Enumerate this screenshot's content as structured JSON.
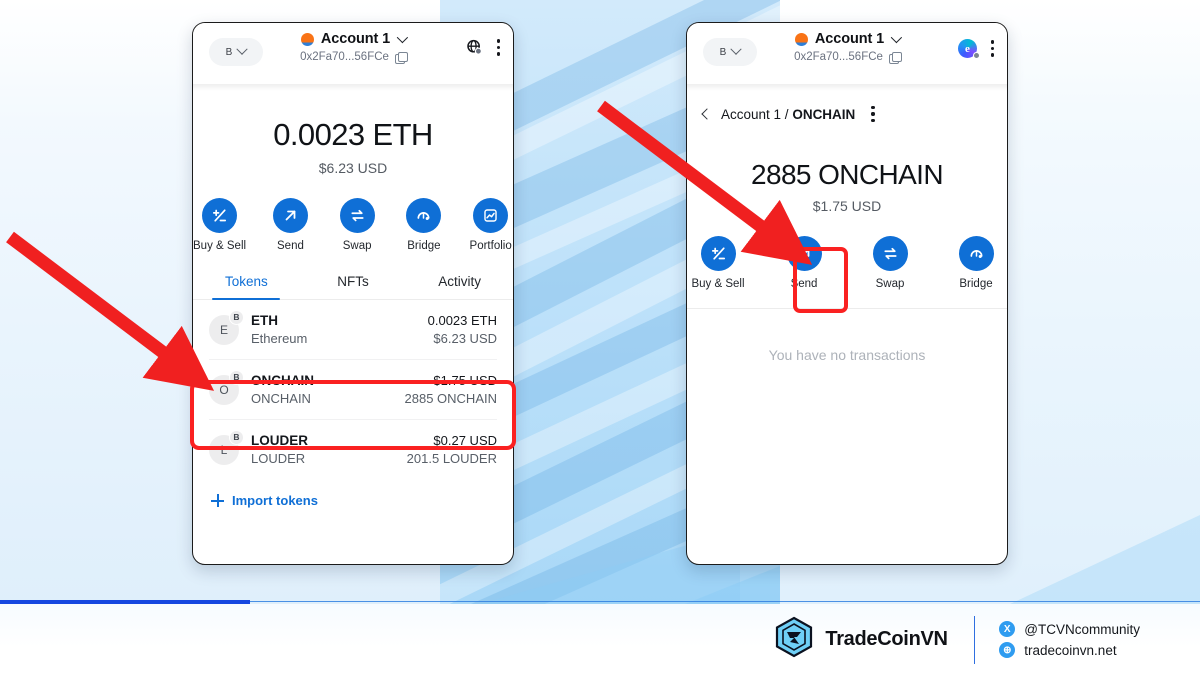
{
  "left_wallet": {
    "header": {
      "network_label": "B",
      "account_name": "Account 1",
      "address": "0x2Fa70...56FCe",
      "network_icon": "globe-network-icon",
      "menu_icon": "kebab-menu-icon",
      "copy_icon": "copy-icon"
    },
    "balance": {
      "primary": "0.0023 ETH",
      "secondary": "$6.23 USD"
    },
    "actions": [
      {
        "label": "Buy & Sell",
        "icon": "plus-minus-icon"
      },
      {
        "label": "Send",
        "icon": "arrow-up-right-icon"
      },
      {
        "label": "Swap",
        "icon": "swap-arrows-icon"
      },
      {
        "label": "Bridge",
        "icon": "bridge-arc-icon"
      },
      {
        "label": "Portfolio",
        "icon": "chart-line-icon"
      }
    ],
    "tabs": [
      {
        "label": "Tokens",
        "active": true
      },
      {
        "label": "NFTs",
        "active": false
      },
      {
        "label": "Activity",
        "active": false
      }
    ],
    "tokens": [
      {
        "letter": "E",
        "badge": "B",
        "symbol": "ETH",
        "name": "Ethereum",
        "value_primary": "0.0023 ETH",
        "value_secondary": "$6.23 USD"
      },
      {
        "letter": "O",
        "badge": "B",
        "symbol": "ONCHAIN",
        "name": "ONCHAIN",
        "value_primary": "$1.75 USD",
        "value_secondary": "2885 ONCHAIN"
      },
      {
        "letter": "L",
        "badge": "B",
        "symbol": "LOUDER",
        "name": "LOUDER",
        "value_primary": "$0.27 USD",
        "value_secondary": "201.5 LOUDER"
      }
    ],
    "import_tokens_label": "Import tokens"
  },
  "right_wallet": {
    "header": {
      "network_label": "B",
      "account_name": "Account 1",
      "address": "0x2Fa70...56FCe",
      "extension_icon": "wallet-extension-icon",
      "menu_icon": "kebab-menu-icon",
      "copy_icon": "copy-icon"
    },
    "breadcrumb": {
      "back_icon": "chevron-left-icon",
      "parent": "Account 1 /",
      "current": "ONCHAIN",
      "menu_icon": "kebab-menu-icon"
    },
    "balance": {
      "primary": "2885 ONCHAIN",
      "secondary": "$1.75 USD"
    },
    "actions": [
      {
        "label": "Buy & Sell",
        "icon": "plus-minus-icon"
      },
      {
        "label": "Send",
        "icon": "arrow-up-right-icon"
      },
      {
        "label": "Swap",
        "icon": "swap-arrows-icon"
      },
      {
        "label": "Bridge",
        "icon": "bridge-arc-icon"
      }
    ],
    "empty_state": "You have no transactions"
  },
  "annotations": {
    "highlight_color": "#fa2121",
    "arrow_color": "#f02020",
    "highlighted_token": "ONCHAIN",
    "highlighted_action": "Send"
  },
  "footer": {
    "brand_name": "TradeCoinVN",
    "brand_icon": "tradecoinvn-hexagon-logo",
    "socials": [
      {
        "icon": "x-twitter-icon",
        "glyph": "X",
        "text": "@TCVNcommunity"
      },
      {
        "icon": "globe-icon",
        "glyph": "⊕",
        "text": "tradecoinvn.net"
      }
    ]
  },
  "theme": {
    "accent_blue": "#0f6fd6",
    "divider_blue": "#2f6fe0",
    "red": "#fa2121",
    "background_blue": "#bfe2fa"
  }
}
